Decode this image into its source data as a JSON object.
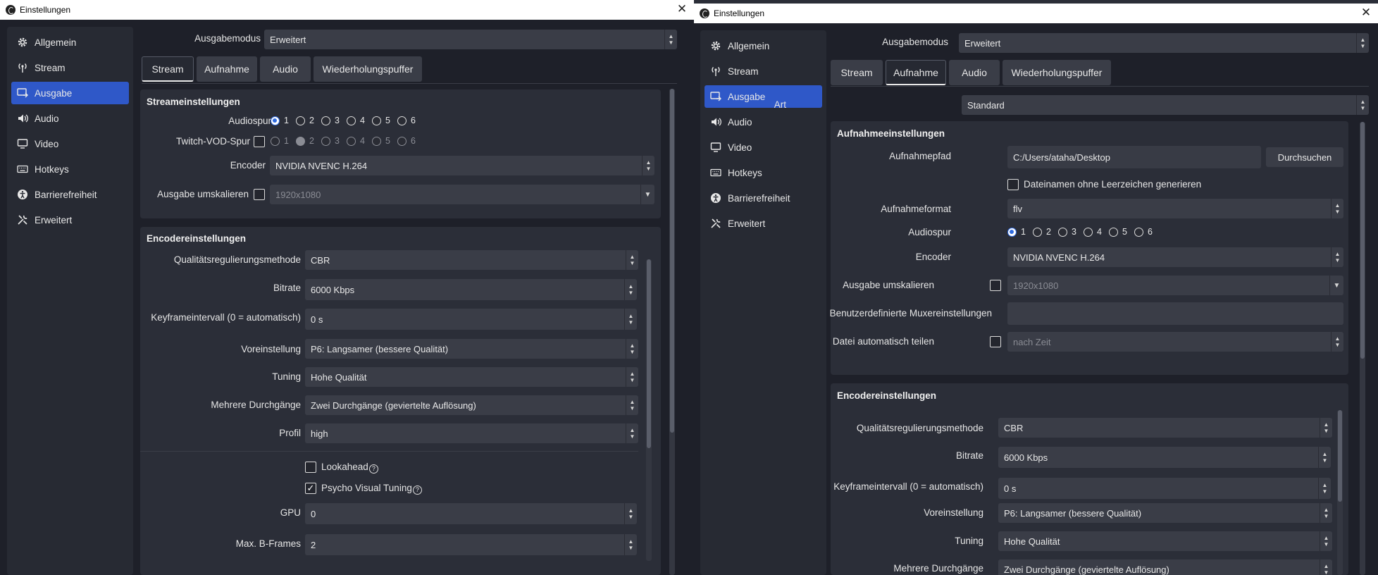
{
  "left": {
    "title": "Einstellungen",
    "sidebar": [
      {
        "label": "Allgemein",
        "icon": "gear-icon"
      },
      {
        "label": "Stream",
        "icon": "broadcast-icon"
      },
      {
        "label": "Ausgabe",
        "icon": "output-icon"
      },
      {
        "label": "Audio",
        "icon": "speaker-icon"
      },
      {
        "label": "Video",
        "icon": "monitor-icon"
      },
      {
        "label": "Hotkeys",
        "icon": "keyboard-icon"
      },
      {
        "label": "Barrierefreiheit",
        "icon": "accessibility-icon"
      },
      {
        "label": "Erweitert",
        "icon": "tools-icon"
      }
    ],
    "output_mode_label": "Ausgabemodus",
    "output_mode_value": "Erweitert",
    "tabs": [
      "Stream",
      "Aufnahme",
      "Audio",
      "Wiederholungspuffer"
    ],
    "stream_group": {
      "title": "Streameinstellungen",
      "audio_track_label": "Audiospur",
      "tracks": [
        "1",
        "2",
        "3",
        "4",
        "5",
        "6"
      ],
      "twitch_label": "Twitch-VOD-Spur",
      "encoder_label": "Encoder",
      "encoder_value": "NVIDIA NVENC H.264",
      "rescale_label": "Ausgabe umskalieren",
      "rescale_value": "1920x1080"
    },
    "encoder_group": {
      "title": "Encodereinstellungen",
      "rate_control_label": "Qualitätsregulierungsmethode",
      "rate_control_value": "CBR",
      "bitrate_label": "Bitrate",
      "bitrate_value": "6000 Kbps",
      "keyframe_label": "Keyframeintervall (0 = automatisch)",
      "keyframe_value": "0 s",
      "preset_label": "Voreinstellung",
      "preset_value": "P6: Langsamer (bessere Qualität)",
      "tuning_label": "Tuning",
      "tuning_value": "Hohe Qualität",
      "multipass_label": "Mehrere Durchgänge",
      "multipass_value": "Zwei Durchgänge (geviertelte Auflösung)",
      "profile_label": "Profil",
      "profile_value": "high",
      "lookahead_label": "Lookahead",
      "psycho_label": "Psycho Visual Tuning",
      "gpu_label": "GPU",
      "gpu_value": "0",
      "bframes_label": "Max. B-Frames",
      "bframes_value": "2"
    }
  },
  "right": {
    "title": "Einstellungen",
    "output_mode_label": "Ausgabemodus",
    "output_mode_value": "Erweitert",
    "tabs": [
      "Stream",
      "Aufnahme",
      "Audio",
      "Wiederholungspuffer"
    ],
    "type_label": "Art",
    "type_value": "Standard",
    "rec_group": {
      "title": "Aufnahmeeinstellungen",
      "path_label": "Aufnahmepfad",
      "path_value": "C:/Users/ataha/Desktop",
      "browse": "Durchsuchen",
      "nospace_label": "Dateinamen ohne Leerzeichen generieren",
      "format_label": "Aufnahmeformat",
      "format_value": "flv",
      "audio_track_label": "Audiospur",
      "encoder_label": "Encoder",
      "encoder_value": "NVIDIA NVENC H.264",
      "rescale_label": "Ausgabe umskalieren",
      "rescale_value": "1920x1080",
      "muxer_label": "Benutzerdefinierte Muxereinstellungen",
      "muxer_value": "",
      "split_label": "Datei automatisch teilen",
      "split_value": "nach Zeit"
    },
    "encoder_group": {
      "title": "Encodereinstellungen",
      "rate_control_label": "Qualitätsregulierungsmethode",
      "rate_control_value": "CBR",
      "bitrate_label": "Bitrate",
      "bitrate_value": "6000 Kbps",
      "keyframe_label": "Keyframeintervall (0 = automatisch)",
      "keyframe_value": "0 s",
      "preset_label": "Voreinstellung",
      "preset_value": "P6: Langsamer (bessere Qualität)",
      "tuning_label": "Tuning",
      "tuning_value": "Hohe Qualität",
      "multipass_label": "Mehrere Durchgänge",
      "multipass_value": "Zwei Durchgänge (geviertelte Auflösung)"
    }
  }
}
